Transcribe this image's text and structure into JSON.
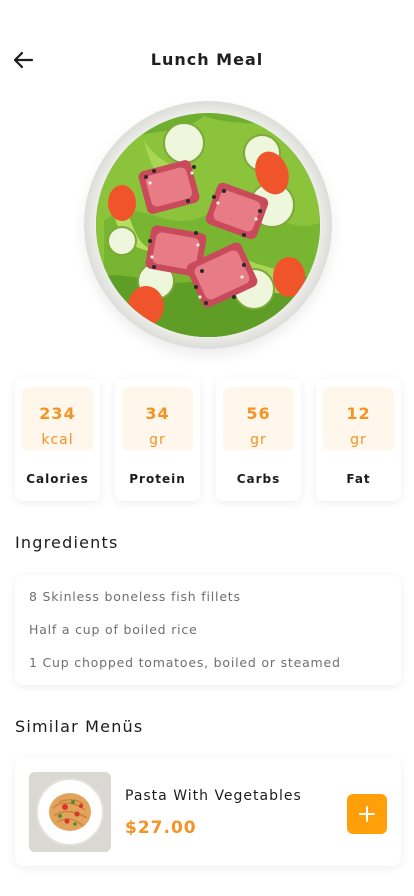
{
  "header": {
    "title": "Lunch Meal",
    "back_icon": "arrow-left-icon"
  },
  "colors": {
    "accent": "#f39425",
    "accent_light": "#fff6ec",
    "text": "#1c1c1c",
    "muted": "#6f6f6f",
    "add_button": "#ff9f0a"
  },
  "nutrition": [
    {
      "value": "234",
      "unit": "kcal",
      "label": "Calories"
    },
    {
      "value": "34",
      "unit": "gr",
      "label": "Protein"
    },
    {
      "value": "56",
      "unit": "gr",
      "label": "Carbs"
    },
    {
      "value": "12",
      "unit": "gr",
      "label": "Fat"
    }
  ],
  "ingredients": {
    "title": "Ingredients",
    "items": [
      "8 Skinless boneless fish fillets",
      "Half a cup of boiled rice",
      "1 Cup chopped tomatoes, boiled or steamed"
    ]
  },
  "similar": {
    "title": "Similar Menüs",
    "items": [
      {
        "name": "Pasta With Vegetables",
        "price": "$27.00",
        "action_icon": "plus-icon"
      }
    ]
  }
}
